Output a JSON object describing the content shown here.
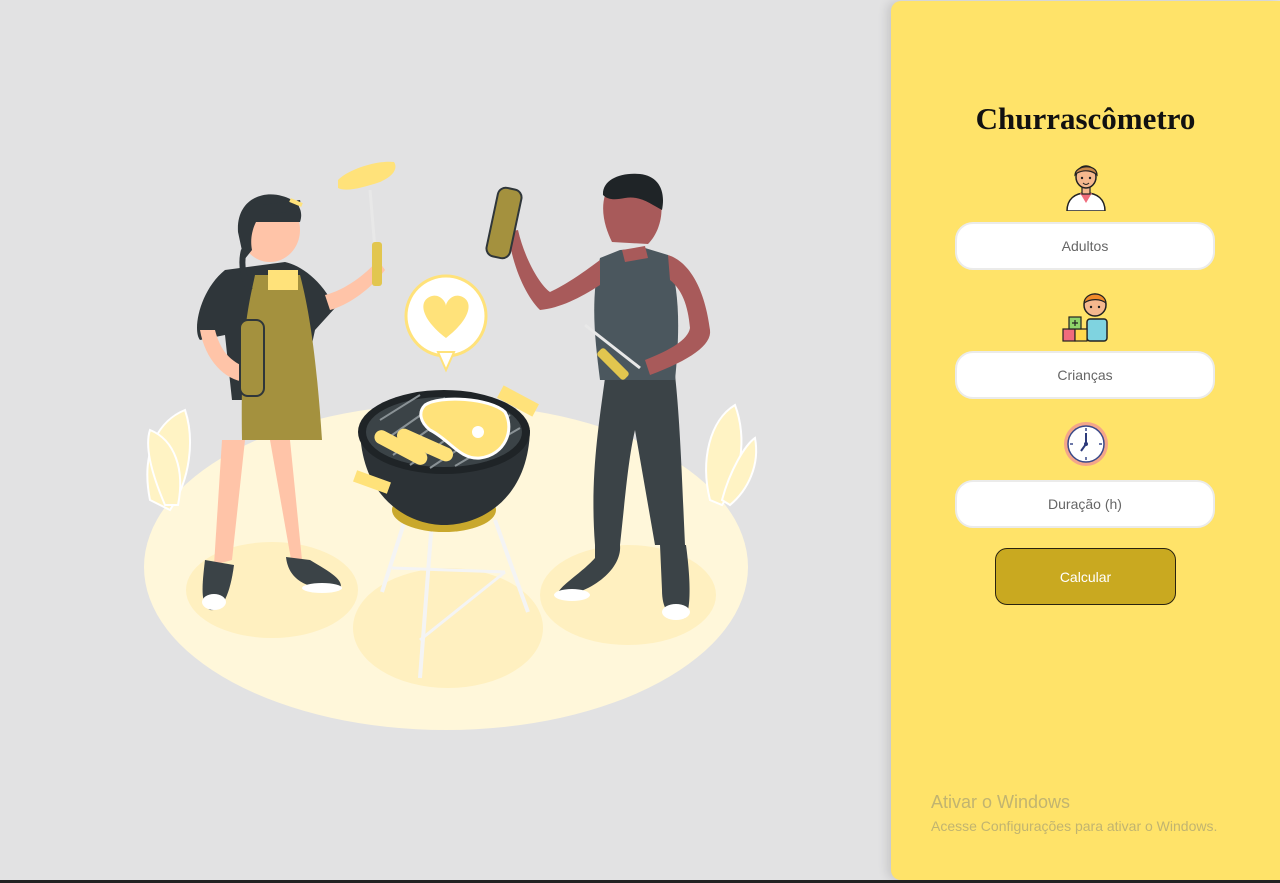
{
  "app": {
    "title": "Churrascômetro"
  },
  "form": {
    "adults_placeholder": "Adultos",
    "children_placeholder": "Crianças",
    "duration_placeholder": "Duração (h)",
    "calculate_label": "Calcular"
  },
  "icons": {
    "adult": "adult-icon",
    "child": "child-icon",
    "clock": "clock-icon",
    "illustration": "barbecue-illustration"
  },
  "colors": {
    "panel": "#ffe369",
    "button": "#c9a920",
    "background": "#e2e2e3"
  },
  "watermark": {
    "title": "Ativar o Windows",
    "subtitle": "Acesse Configurações para ativar o Windows."
  }
}
